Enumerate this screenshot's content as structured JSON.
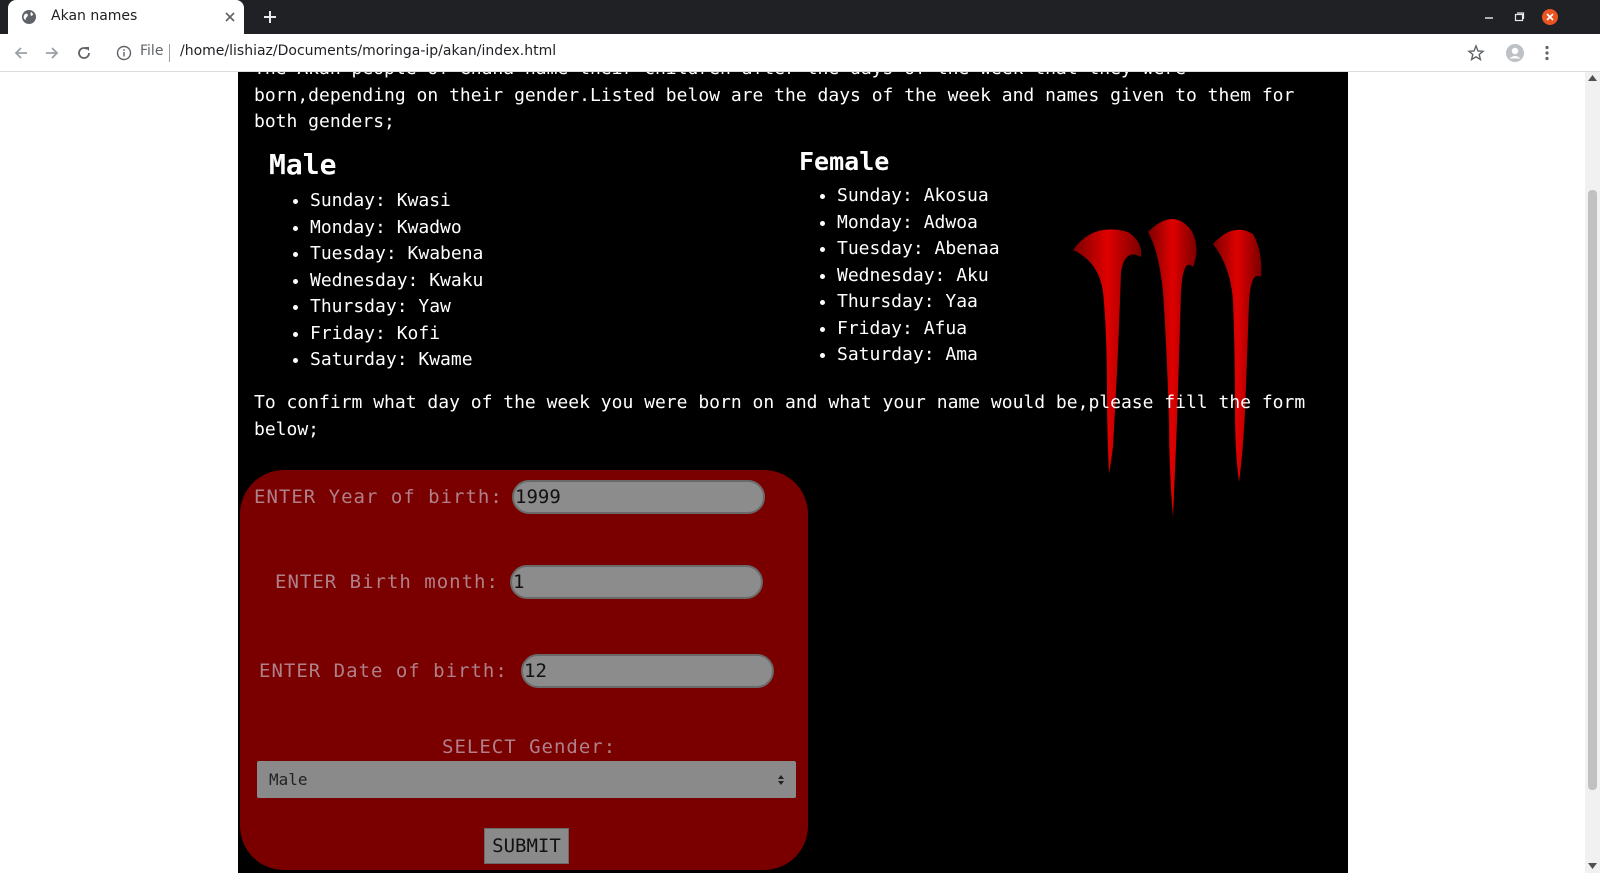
{
  "browser": {
    "tab_title": "Akan names",
    "file_label": "File",
    "url": "/home/lishiaz/Documents/moringa-ip/akan/index.html"
  },
  "page": {
    "intro": "The Akan people of Ghana name their children after the days of the week that they were born,depending on their gender.Listed below are the days of the week and names given to them for both genders;",
    "male": {
      "title": "Male",
      "items": [
        "Sunday: Kwasi",
        "Monday: Kwadwo",
        "Tuesday: Kwabena",
        "Wednesday: Kwaku",
        "Thursday: Yaw",
        "Friday: Kofi",
        "Saturday: Kwame"
      ]
    },
    "female": {
      "title": "Female",
      "items": [
        "Sunday: Akosua",
        "Monday: Adwoa",
        "Tuesday: Abenaa",
        "Wednesday: Aku",
        "Thursday: Yaa",
        "Friday: Afua",
        "Saturday: Ama"
      ]
    },
    "confirm": "To confirm what day of the week you were born on and what your name would be,please fill the form below;",
    "form": {
      "year_label": "ENTER Year of birth:",
      "year_value": "1999",
      "month_label": "ENTER Birth month:",
      "month_value": "1",
      "date_label": "ENTER Date of birth:",
      "date_value": "12",
      "gender_label": "SELECT Gender:",
      "gender_value": "Male",
      "submit_label": "SUBMIT"
    }
  },
  "colors": {
    "page_bg": "#000000",
    "form_bg": "#7a0000",
    "claw": "#c00000"
  },
  "icons": [
    "globe-icon",
    "close-icon",
    "plus-icon",
    "back-icon",
    "forward-icon",
    "reload-icon",
    "info-icon",
    "star-icon",
    "profile-icon",
    "menu-icon",
    "minimize-icon",
    "maximize-icon",
    "window-close-icon",
    "select-arrow-icon"
  ]
}
